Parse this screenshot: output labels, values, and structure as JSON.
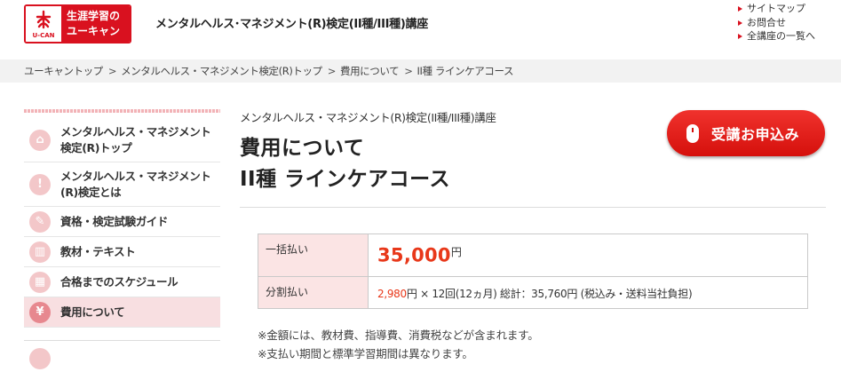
{
  "header": {
    "logo": {
      "mark_text": "U-CAN",
      "line1": "生涯学習の",
      "line2": "ユーキャン"
    },
    "site_title": "メンタルヘルス･マネジメント(R)検定(II種/III種)講座",
    "util_links": [
      "サイトマップ",
      "お問合せ",
      "全講座の一覧へ"
    ]
  },
  "breadcrumb": [
    "ユーキャントップ",
    "メンタルヘルス・マネジメント検定(R)トップ",
    "費用について",
    "II種 ラインケアコース"
  ],
  "sidebar": {
    "items": [
      {
        "line1": "メンタルヘルス・マネジメント",
        "line2": "検定(R)トップ",
        "icon": "home-icon",
        "glyph": "⌂"
      },
      {
        "line1": "メンタルヘルス・マネジメント",
        "line2": "(R)検定とは",
        "icon": "lightbulb-icon",
        "glyph": "!"
      },
      {
        "line1": "資格・検定試験ガイド",
        "line2": "",
        "icon": "clipboard-icon",
        "glyph": "✎"
      },
      {
        "line1": "教材・テキスト",
        "line2": "",
        "icon": "book-icon",
        "glyph": "▥"
      },
      {
        "line1": "合格までのスケジュール",
        "line2": "",
        "icon": "calendar-icon",
        "glyph": "▦"
      },
      {
        "line1": "費用について",
        "line2": "",
        "icon": "yen-icon",
        "glyph": "¥"
      }
    ]
  },
  "main": {
    "course_sub": "メンタルヘルス・マネジメント(R)検定(II種/III種)講座",
    "title_line1": "費用について",
    "title_line2": "II種 ラインケアコース",
    "apply_button": "受講お申込み",
    "fees": {
      "lump_label": "一括払い",
      "lump_amount": "35,000",
      "yen": "円",
      "installment_label": "分割払い",
      "installment_amount": "2,980",
      "installment_rest": "円 × 12回(12ヵ月) 総計：35,760円 (税込み・送料当社負担)"
    },
    "notes": [
      "※金額には、教材費、指導費、消費税などが含まれます。",
      "※支払い期間と標準学習期間は異なります。"
    ]
  },
  "colors": {
    "brand_red": "#d9111f",
    "price_red": "#e8381a",
    "table_header_bg": "#fbe4e4",
    "active_nav_bg": "#f8dfe1"
  }
}
